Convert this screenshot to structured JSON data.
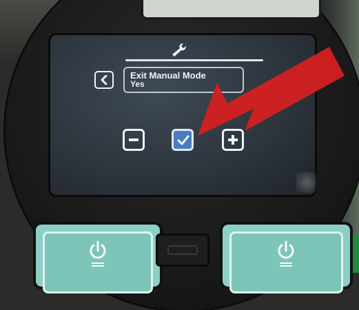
{
  "screen": {
    "header_icon": "wrench-icon",
    "back_icon": "chevron-left-icon",
    "setting": {
      "title": "Exit Manual Mode",
      "value": "Yes"
    },
    "controls": {
      "decrease_icon": "minus-icon",
      "confirm_icon": "checkmark-icon",
      "increase_icon": "plus-icon"
    }
  },
  "hardware": {
    "left_power_icon": "power-icon",
    "right_power_icon": "power-icon",
    "port_icon": "usb-icon"
  },
  "annotation": {
    "arrow_color": "#d42020"
  },
  "colors": {
    "screen_bg": "#2c343c",
    "confirm_accent": "#4c7cc0",
    "power_button": "#8ccfc4"
  }
}
